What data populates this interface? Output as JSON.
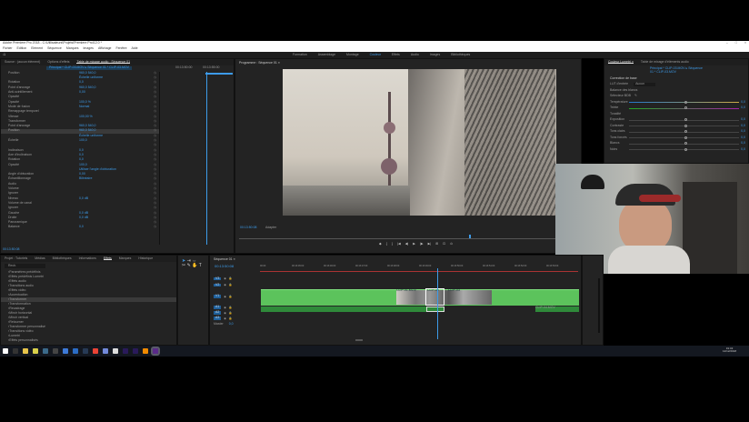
{
  "window": {
    "title": "Adobe Premiere Pro 2018 - C:\\Utilisateurs\\Projets\\Premiere Pro\\12.0 *",
    "controls": [
      "–",
      "□",
      "×"
    ]
  },
  "menu": [
    "Fichier",
    "Edition",
    "Elément",
    "Séquence",
    "Marques",
    "Images",
    "Affichage",
    "Fenêtre",
    "Aide"
  ],
  "workspaces": [
    "Formation",
    "Assemblage",
    "Montage",
    "Couleur",
    "Effets",
    "Audio",
    "Images",
    "Bibliothèques"
  ],
  "active_workspace": 3,
  "effects_panel": {
    "tabs": [
      "Source : (aucun élément)",
      "Options d'effets",
      "Table de mixage audio : Séquence 01"
    ],
    "active_tab": 2,
    "clip_label": "Principal * CLIP-03.MOV ▸ Séquence 01 * CLIP-03.MOV",
    "timecodes": [
      "00:13:50:00",
      "00:13:55:00"
    ],
    "rows": [
      {
        "l": "Position",
        "v": "960,0  540,0"
      },
      {
        "l": "",
        "v": "Échelle uniforme"
      },
      {
        "l": "Rotation",
        "v": "0,0"
      },
      {
        "l": "Point d'ancrage",
        "v": "960,0  540,0"
      },
      {
        "l": "Anti-scintillement",
        "v": "0,00"
      },
      {
        "l": "Opacité",
        "v": ""
      },
      {
        "l": "Opacité",
        "v": "100,0 %"
      },
      {
        "l": "Mode de fusion",
        "v": "Normal"
      },
      {
        "l": "Remappage temporel",
        "v": ""
      },
      {
        "l": "Vitesse",
        "v": "100,00 %"
      },
      {
        "l": "Transformer",
        "v": ""
      },
      {
        "l": "Point d'ancrage",
        "v": "960,0  540,0"
      },
      {
        "l": "Position",
        "v": "960,0  540,0"
      },
      {
        "l": "",
        "v": "Échelle uniforme"
      },
      {
        "l": "Échelle",
        "v": "100,0"
      },
      {
        "l": "",
        "v": ""
      },
      {
        "l": "Inclinaison",
        "v": "0,0"
      },
      {
        "l": "Axe d'inclinaison",
        "v": "0,0"
      },
      {
        "l": "Rotation",
        "v": "0,0"
      },
      {
        "l": "Opacité",
        "v": "100,0"
      },
      {
        "l": "",
        "v": "Utiliser l'angle d'obturation"
      },
      {
        "l": "Angle d'obturation",
        "v": "0,00"
      },
      {
        "l": "Échantillonnage",
        "v": "Bilinéaire"
      },
      {
        "l": "Audio",
        "v": ""
      },
      {
        "l": "Volume",
        "v": ""
      },
      {
        "l": "Ignorer",
        "v": ""
      },
      {
        "l": "Niveau",
        "v": "0,0 dB"
      },
      {
        "l": "Volume de canal",
        "v": ""
      },
      {
        "l": "Ignorer",
        "v": ""
      },
      {
        "l": "Gauche",
        "v": "0,0 dB"
      },
      {
        "l": "Droite",
        "v": "0,0 dB"
      },
      {
        "l": "Panoramique",
        "v": ""
      },
      {
        "l": "Balance",
        "v": "0,0"
      }
    ],
    "selected_row": 12,
    "footer_time": "00:13:50:08"
  },
  "program": {
    "title": "Programme : Séquence 01 ≡",
    "timecode": "00:13:50:08",
    "fit": "Adapter",
    "controls": [
      "◆",
      "{",
      "}",
      "|◀",
      "◀|",
      "▶",
      "|▶",
      "▶|",
      "⊞",
      "⊡",
      "⊙"
    ]
  },
  "lumetri": {
    "tabs": [
      "Couleur Lumetri ≡",
      "Table de mixage d'éléments audio"
    ],
    "clip_label": "Principal * CLIP-03.MOV ▸ Séquence 01 * CLIP-03.MOV",
    "section": "Correction de base",
    "lut_label": "LUT d'entrée",
    "lut_value": "Aucun",
    "wb_label": "Balance des blancs",
    "picker_label": "Sélecteur BDB",
    "sliders": [
      {
        "l": "Température",
        "v": "0,0"
      },
      {
        "l": "Teinte",
        "v": "0,0"
      }
    ],
    "tone_label": "Tonalité",
    "tone": [
      {
        "l": "Exposition",
        "v": "0,0"
      },
      {
        "l": "Contraste",
        "v": "0,0"
      },
      {
        "l": "Tons clairs",
        "v": "0,0"
      },
      {
        "l": "Tons foncés",
        "v": "0,0"
      },
      {
        "l": "Blancs",
        "v": "0,0"
      },
      {
        "l": "Noirs",
        "v": "0,0"
      }
    ]
  },
  "project": {
    "tabs": [
      "Projet : Tutoriels",
      "Médias",
      "Bibliothèques",
      "Informations",
      "Effets",
      "Marques",
      "Historique"
    ],
    "active_tab": 4,
    "search_placeholder": "Rech.",
    "items": [
      "Paramètres prédéfinis",
      "Effets prédéfinis Lumetri",
      "Effets audio",
      "Transitions audio",
      "Effets vidéo",
      "Accentuation",
      "Transformer",
      "Transformation",
      "Recadrage",
      "Miroir horizontal",
      "Miroir vertical",
      "Retourner",
      "Transformer personnalisé",
      "Transitions vidéo",
      "Lumetri",
      "Effets personnalisés"
    ],
    "selected": 6
  },
  "timeline": {
    "title": "Séquence 01 ≡",
    "timecode": "00:13:50:08",
    "ticks": [
      "00:00",
      "00:13:45:00",
      "00:13:46:00",
      "00:13:47:00",
      "00:13:48:00",
      "00:13:49:00",
      "00:13:50:00",
      "00:13:51:00",
      "00:13:52:00",
      "00:13:53:00"
    ],
    "tracks": [
      "V3",
      "V2",
      "V1",
      "A1",
      "A2",
      "A3"
    ],
    "master": "Master",
    "master_val": "0,0",
    "clips": [
      "CLIP-01.MOV",
      "CLIP-02",
      "CLIP-03",
      "CLIP-04.MOV"
    ]
  },
  "taskbar_icons": [
    "start",
    "task-view",
    "explorer",
    "sticky",
    "calc",
    "camera",
    "edge",
    "chrome-alt",
    "steam",
    "chrome",
    "discord",
    "settings",
    "premiere",
    "after-effects",
    "vlc",
    "obs"
  ],
  "clock": {
    "time": "19:43",
    "date": "12/12/2018"
  }
}
